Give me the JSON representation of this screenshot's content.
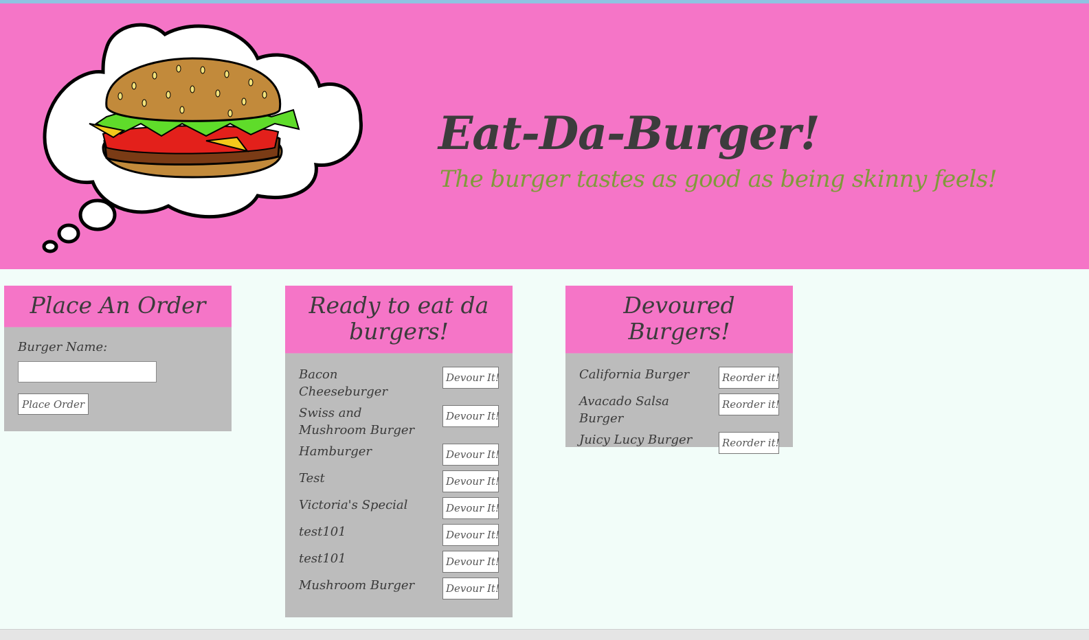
{
  "header": {
    "title": "Eat-Da-Burger!",
    "subtitle": "The burger tastes as good as being skinny feels!",
    "logo_icon": "burger-thought-bubble-icon",
    "background": "#f575c7"
  },
  "order_panel": {
    "heading": "Place An Order",
    "field_label": "Burger Name:",
    "field_value": "",
    "button_label": "Place Order"
  },
  "ready_panel": {
    "heading": "Ready to eat da burgers!",
    "items": [
      {
        "name": "Bacon Cheeseburger",
        "button": "Devour It!"
      },
      {
        "name": "Swiss and Mushroom Burger",
        "button": "Devour It!"
      },
      {
        "name": "Hamburger",
        "button": "Devour It!"
      },
      {
        "name": "Test",
        "button": "Devour It!"
      },
      {
        "name": "Victoria's Special",
        "button": "Devour It!"
      },
      {
        "name": "test101",
        "button": "Devour It!"
      },
      {
        "name": "test101",
        "button": "Devour It!"
      },
      {
        "name": "Mushroom Burger",
        "button": "Devour It!"
      }
    ]
  },
  "devoured_panel": {
    "heading": "Devoured Burgers!",
    "items": [
      {
        "name": "California Burger",
        "button": "Reorder it!"
      },
      {
        "name": "Avacado Salsa Burger",
        "button": "Reorder it!"
      },
      {
        "name": "Juicy Lucy Burger",
        "button": "Reorder it!"
      }
    ]
  }
}
